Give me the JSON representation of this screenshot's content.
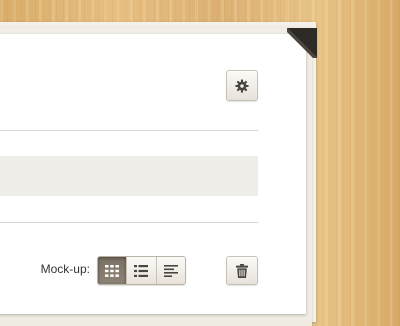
{
  "toolbar": {
    "mockup_label": "Mock-up:",
    "settings_icon": "gear-icon",
    "trash_icon": "trash-icon",
    "view_modes": [
      {
        "icon": "grid-icon",
        "active": true
      },
      {
        "icon": "list-icon",
        "active": false
      },
      {
        "icon": "text-icon",
        "active": false
      }
    ]
  },
  "colors": {
    "wood": "#e0b677",
    "paper": "#ffffff",
    "active_segment": "#82796b",
    "divider": "#d9d6cf"
  }
}
